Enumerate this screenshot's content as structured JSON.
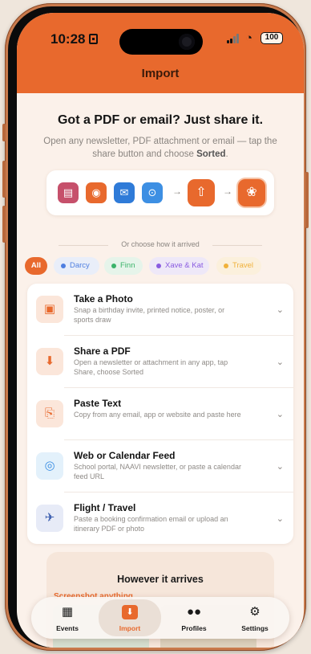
{
  "status_bar": {
    "time": "10:28",
    "battery": "100"
  },
  "header": {
    "title": "Import"
  },
  "hero": {
    "title": "Got a PDF or email? Just share it.",
    "subtitle_prefix": "Open any newsletter, PDF attachment or email — tap the share button and choose ",
    "subtitle_app": "Sorted",
    "subtitle_suffix": ".",
    "flow_icons": [
      "pdf-file-icon",
      "camera-icon",
      "mail-icon",
      "safari-icon",
      "share-icon",
      "sorted-logo-icon"
    ]
  },
  "divider": {
    "label": "Or choose how it arrived"
  },
  "filters": [
    {
      "label": "All",
      "color": "#e8692d"
    },
    {
      "label": "Darcy",
      "color": "#4f7fe0"
    },
    {
      "label": "Finn",
      "color": "#3bb36a"
    },
    {
      "label": "Xave & Kat",
      "color": "#8a5ce0"
    },
    {
      "label": "Travel",
      "color": "#f0b13a"
    }
  ],
  "sources": [
    {
      "title": "Take a Photo",
      "desc": "Snap a birthday invite, printed notice, poster, or sports draw",
      "icon": "camera-scan-icon"
    },
    {
      "title": "Share a PDF",
      "desc": "Open a newsletter or attachment in any app, tap Share, choose Sorted",
      "icon": "pdf-share-icon"
    },
    {
      "title": "Paste Text",
      "desc": "Copy from any email, app or website and paste here",
      "icon": "clipboard-icon"
    },
    {
      "title": "Web or Calendar Feed",
      "desc": "School portal, NAAVI newsletter, or paste a calendar feed URL",
      "icon": "globe-icon"
    },
    {
      "title": "Flight / Travel",
      "desc": "Paste a booking confirmation email or upload an itinerary PDF or photo",
      "icon": "airplane-icon"
    }
  ],
  "later": {
    "title": "However it arrives",
    "subtitle": "Screenshot anything"
  },
  "tabs": [
    {
      "label": "Events",
      "icon": "calendar-icon"
    },
    {
      "label": "Import",
      "icon": "import-icon"
    },
    {
      "label": "Profiles",
      "icon": "people-icon"
    },
    {
      "label": "Settings",
      "icon": "gear-icon"
    }
  ],
  "colors": {
    "accent": "#e8692d",
    "background": "#fbf1ea"
  }
}
